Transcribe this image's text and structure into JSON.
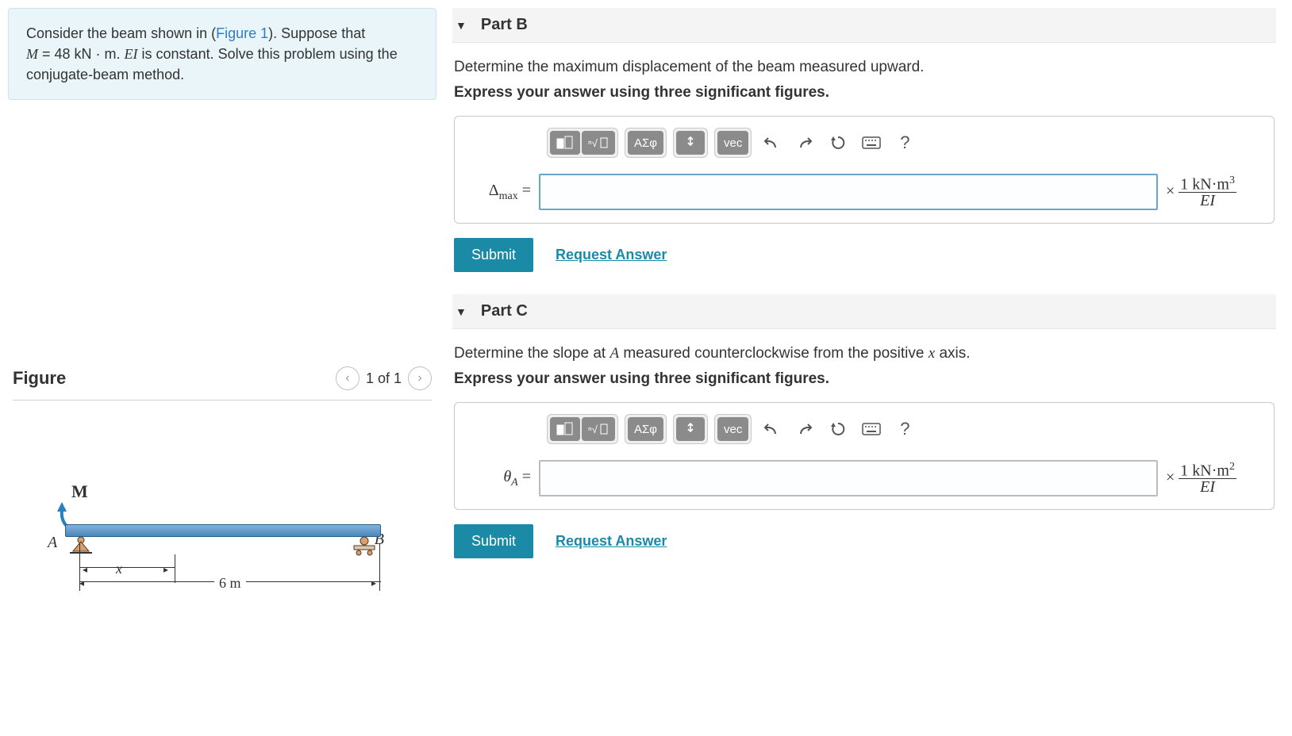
{
  "problem": {
    "line1_pre": "Consider the beam shown in (",
    "figure_link": "Figure 1",
    "line1_post": "). Suppose that ",
    "line2_a": "M",
    "line2_b": " = 48 kN · m. ",
    "line2_c": "EI",
    "line2_d": " is constant. Solve this problem using the conjugate-beam method."
  },
  "figure": {
    "title": "Figure",
    "counter": "1 of 1",
    "M": "M",
    "A": "A",
    "B": "B",
    "x": "x",
    "len": "6 m"
  },
  "toolbar": {
    "greek": "ΑΣφ",
    "vec": "vec"
  },
  "partB": {
    "title": "Part B",
    "desc": "Determine the maximum displacement of the beam measured upward.",
    "hint": "Express your answer using three significant figures.",
    "var_pre": "Δ",
    "var_sub": "max",
    "eq": " = ",
    "unit_top": "1 kN·m",
    "unit_exp": "3",
    "unit_bot": "EI",
    "submit": "Submit",
    "request": "Request Answer"
  },
  "partC": {
    "title": "Part C",
    "desc_pre": "Determine the slope at ",
    "desc_A": "A",
    "desc_mid": " measured counterclockwise from the positive ",
    "desc_x": "x",
    "desc_post": " axis.",
    "hint": "Express your answer using three significant figures.",
    "var_pre": "θ",
    "var_sub": "A",
    "eq": " = ",
    "unit_top": "1 kN·m",
    "unit_exp": "2",
    "unit_bot": "EI",
    "submit": "Submit",
    "request": "Request Answer"
  }
}
